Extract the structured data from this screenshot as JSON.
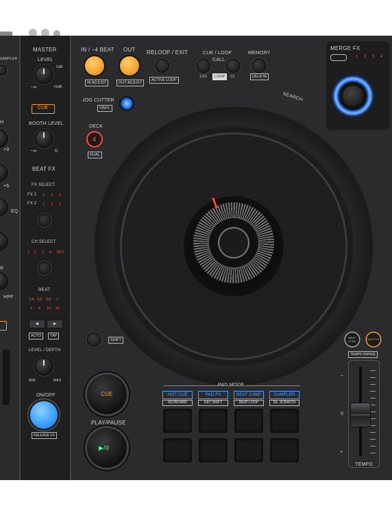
{
  "image_alt": "Pioneer DJ controller deck close-up",
  "left_labels": {
    "sampler": "SAMPLER",
    "eq": "EQ",
    "hpf": "HPF",
    "r": "R",
    "plus6": "+6",
    "plus9": "+9",
    "h": "H"
  },
  "mixer": {
    "master": "MASTER",
    "level": "LEVEL",
    "level_min": "−∞",
    "level_max": "+5dB",
    "level_mid": "0dB",
    "cue": "CUE",
    "booth_level": "BOOTH LEVEL",
    "booth_min": "−∞",
    "booth_max": "0",
    "beat_fx": "BEAT FX",
    "fx_select": "FX SELECT",
    "fx1": "FX 1",
    "fx2": "FX 2",
    "fx_nums": [
      "1",
      "2",
      "3"
    ],
    "ch_select": "CH SELECT",
    "ch_nums": [
      "1",
      "2",
      "3",
      "4",
      "MST"
    ],
    "beat": "BEAT",
    "beat_row1": [
      "1/4",
      "1/2",
      "3/4",
      "1"
    ],
    "beat_row2": [
      "4",
      "8",
      "16",
      "32"
    ],
    "auto": "AUTO",
    "tap": "TAP",
    "level_depth": "LEVEL / DEPTH",
    "min": "MIN",
    "max": "MAX",
    "on_off": "ON/OFF",
    "release_fx": "RELEASE FX"
  },
  "top": {
    "in_4beat": "IN / −4 BEAT",
    "out": "OUT",
    "reloop_exit": "RELOOP / EXIT",
    "in_adjust": "IN ADJUST",
    "out_adjust": "OUT ADJUST",
    "active_loop": "ACTIVE LOOP",
    "cue_loop": "CUE / LOOP",
    "call": "CALL",
    "memory": "MEMORY",
    "half_x": "1/2X",
    "loop": "LOOP",
    "two_x": "2X",
    "delete": "DELETE",
    "merge_fx": "MERGE FX",
    "merge_nums": [
      "1",
      "2",
      "3",
      "4"
    ],
    "search": "SEARCH"
  },
  "deck": {
    "jog_cutter": "JOG CUTTER",
    "vinyl": "VINYL",
    "deck": "DECK",
    "deck_num": "4",
    "dual": "DUAL",
    "shift": "SHIFT",
    "cue": "CUE",
    "play_pause": "PLAY/PAUSE",
    "play_glyph": "▶/II"
  },
  "pads": {
    "pad_mode": "PAD MODE",
    "modes": [
      {
        "label": "HOT CUE",
        "sub": "KEYBOARD"
      },
      {
        "label": "PAD FX",
        "sub": "KEY SHIFT"
      },
      {
        "label": "BEAT JUMP",
        "sub": "BEAT LOOP"
      },
      {
        "label": "SAMPLER",
        "sub": "SE. SCRATCH"
      }
    ]
  },
  "tempo": {
    "beat_sync": "BEAT SYNC",
    "master": "MASTER",
    "tempo_range": "TEMPO RANGE",
    "minus": "−",
    "zero": "0",
    "plus": "+",
    "tempo": "TEMPO"
  },
  "colors": {
    "accent_blue": "#2f7fff",
    "orange": "#f2a233",
    "red_text": "#ff5040",
    "pad_blue": "#4da3ff"
  }
}
